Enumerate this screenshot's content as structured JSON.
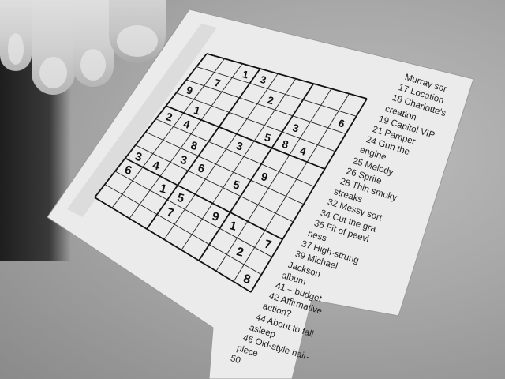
{
  "sudoku": {
    "givens": [
      {
        "r": 0,
        "c": 2,
        "v": "1"
      },
      {
        "r": 0,
        "c": 3,
        "v": "3"
      },
      {
        "r": 1,
        "c": 1,
        "v": "7"
      },
      {
        "r": 1,
        "c": 4,
        "v": "2"
      },
      {
        "r": 1,
        "c": 8,
        "v": "6"
      },
      {
        "r": 2,
        "c": 0,
        "v": "9"
      },
      {
        "r": 2,
        "c": 6,
        "v": "3"
      },
      {
        "r": 3,
        "c": 1,
        "v": "1"
      },
      {
        "r": 3,
        "c": 5,
        "v": "5"
      },
      {
        "r": 3,
        "c": 6,
        "v": "8"
      },
      {
        "r": 3,
        "c": 7,
        "v": "4"
      },
      {
        "r": 4,
        "c": 0,
        "v": "2"
      },
      {
        "r": 4,
        "c": 1,
        "v": "4"
      },
      {
        "r": 4,
        "c": 4,
        "v": "3"
      },
      {
        "r": 5,
        "c": 2,
        "v": "8"
      },
      {
        "r": 5,
        "c": 6,
        "v": "9"
      },
      {
        "r": 6,
        "c": 2,
        "v": "3"
      },
      {
        "r": 6,
        "c": 3,
        "v": "6"
      },
      {
        "r": 6,
        "c": 5,
        "v": "5"
      },
      {
        "r": 7,
        "c": 0,
        "v": "3"
      },
      {
        "r": 7,
        "c": 1,
        "v": "4"
      },
      {
        "r": 8,
        "c": 0,
        "v": "6"
      },
      {
        "r": 8,
        "c": 2,
        "v": "1"
      },
      {
        "r": 8,
        "c": 3,
        "v": "5"
      },
      {
        "r": 8,
        "c": 5,
        "v": "9"
      },
      {
        "r": 8,
        "c": 6,
        "v": "1"
      },
      {
        "r": 8,
        "c": 8,
        "v": "7"
      },
      {
        "r": 9,
        "c": 3,
        "v": "7"
      },
      {
        "r": 9,
        "c": 7,
        "v": "2"
      },
      {
        "r": 10,
        "c": 8,
        "v": "8"
      }
    ]
  },
  "clues": [
    "Murray sor",
    "17 Location",
    "18 Charlotte's",
    "creation",
    "19 Capitol VIP",
    "21 Pamper",
    "24 Gun the",
    "engine",
    "25 Melody",
    "26 Sprite",
    "28 Thin smoky",
    "streaks",
    "32 Messy sort",
    "34 Cut the gra",
    "36 Fit of peevi",
    "ness",
    "37 High-strung",
    "39 Michael",
    "Jackson",
    "album",
    "41 – budget",
    "42 Affirmative",
    "action?",
    "44 About to fall",
    "asleep",
    "46 Old-style hair-",
    "piece",
    "50"
  ]
}
